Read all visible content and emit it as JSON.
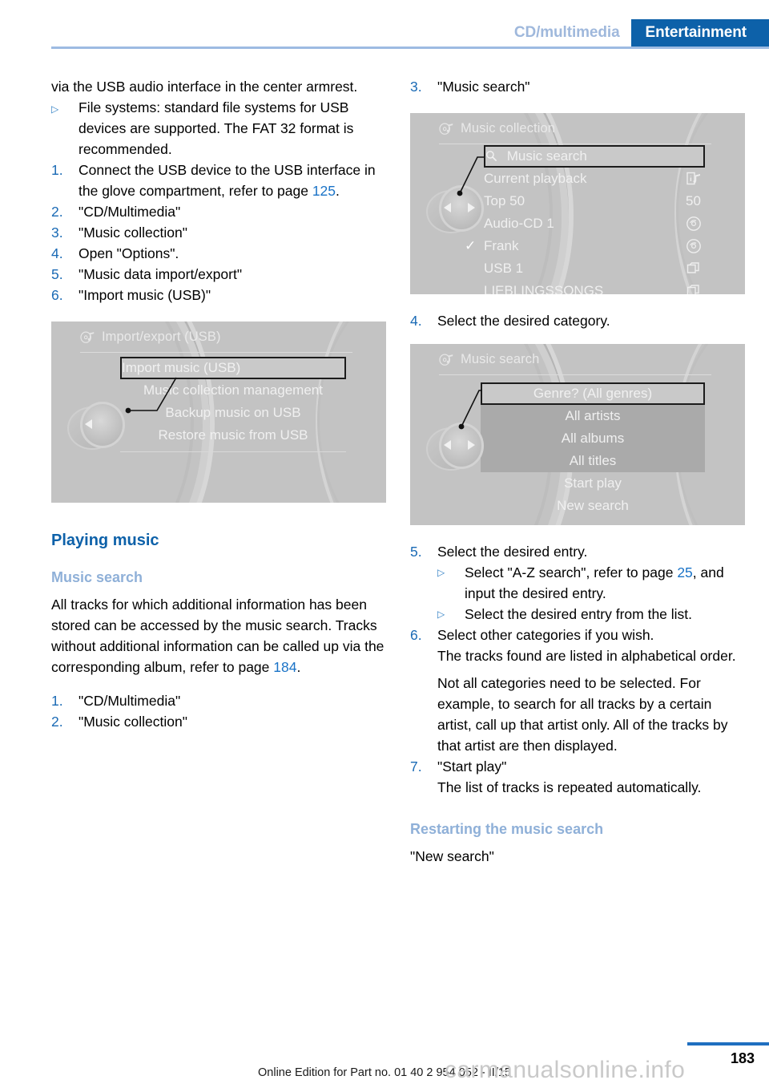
{
  "header": {
    "tab_inactive": "CD/multimedia",
    "tab_active": "Entertainment",
    "accent_color": "#0d61a9",
    "inactive_color": "#9fb8dc"
  },
  "left_column": {
    "intro_continued": "via the USB audio interface in the center armrest.",
    "bullet_filesystems": {
      "marker": "▷",
      "text": "File systems: standard file systems for USB devices are supported. The FAT 32 format is recommended."
    },
    "steps": [
      {
        "marker": "1.",
        "text_before": "Connect the USB device to the USB interface in the glove compartment, refer to page ",
        "page_ref": "125",
        "text_after": "."
      },
      {
        "marker": "2.",
        "text": "\"CD/Multimedia\""
      },
      {
        "marker": "3.",
        "text": "\"Music collection\""
      },
      {
        "marker": "4.",
        "text": "Open \"Options\"."
      },
      {
        "marker": "5.",
        "text": "\"Music data import/export\""
      },
      {
        "marker": "6.",
        "text": "\"Import music (USB)\""
      }
    ],
    "screen_import_export": {
      "title": "Import/export (USB)",
      "title_icon": "cd-music-icon",
      "items": [
        {
          "label": "Import music (USB)",
          "state": "selected"
        },
        {
          "label": "Music collection management",
          "state": "normal"
        },
        {
          "label": "Backup music on USB",
          "state": "normal"
        },
        {
          "label": "Restore music from USB",
          "state": "normal"
        }
      ]
    },
    "heading_playing_music": "Playing music",
    "heading_music_search": "Music search",
    "body_music_search": {
      "text_before": "All tracks for which additional information has been stored can be accessed by the music search. Tracks without additional information can be called up via the corresponding album, refer to page ",
      "page_ref": "184",
      "text_after": "."
    },
    "steps2": [
      {
        "marker": "1.",
        "text": "\"CD/Multimedia\""
      },
      {
        "marker": "2.",
        "text": "\"Music collection\""
      }
    ]
  },
  "right_column": {
    "step3": {
      "marker": "3.",
      "text": "\"Music search\""
    },
    "screen_music_collection": {
      "title": "Music collection",
      "title_icon": "cd-music-icon",
      "items": [
        {
          "label": "Music search",
          "state": "selected",
          "icon": "magnifier-icon",
          "right_icon": ""
        },
        {
          "label": "Current playback",
          "state": "normal",
          "right_icon": "info-music-icon"
        },
        {
          "label": "Top 50",
          "state": "normal",
          "right_icon": "50"
        },
        {
          "label": "Audio-CD 1",
          "state": "normal",
          "right_icon": "disc-icon"
        },
        {
          "label": "Frank",
          "state": "checked",
          "right_icon": "disc-icon"
        },
        {
          "label": "USB 1",
          "state": "normal",
          "right_icon": "folder-icon"
        },
        {
          "label": "LIEBLINGSSONGS",
          "state": "normal",
          "right_icon": "folder-icon"
        }
      ]
    },
    "step4": {
      "marker": "4.",
      "text": "Select the desired category."
    },
    "screen_music_search": {
      "title": "Music search",
      "title_icon": "cd-music-icon",
      "items": [
        {
          "label": "Genre? (All genres)",
          "state": "selected"
        },
        {
          "label": "All artists",
          "state": "highlight"
        },
        {
          "label": "All albums",
          "state": "highlight"
        },
        {
          "label": "All titles",
          "state": "highlight"
        },
        {
          "label": "Start play",
          "state": "normal"
        },
        {
          "label": "New search",
          "state": "normal"
        }
      ]
    },
    "step5": {
      "marker": "5.",
      "text": "Select the desired entry."
    },
    "step5_sub": [
      {
        "marker": "▷",
        "text_before": "Select \"A-Z search\", refer to page ",
        "page_ref": "25",
        "text_after": ", and input the desired entry."
      },
      {
        "marker": "▷",
        "text": "Select the desired entry from the list."
      }
    ],
    "step6": {
      "marker": "6.",
      "text": "Select other categories if you wish."
    },
    "step6_note1": "The tracks found are listed in alphabetical order.",
    "step6_note2": "Not all categories need to be selected. For example, to search for all tracks by a certain artist, call up that artist only. All of the tracks by that artist are then displayed.",
    "step7": {
      "marker": "7.",
      "text": "\"Start play\""
    },
    "step7_note": "The list of tracks is repeated automatically.",
    "heading_restarting": "Restarting the music search",
    "body_restarting": "\"New search\""
  },
  "footer": {
    "page_number": "183",
    "edition": "Online Edition for Part no. 01 40 2 954 052 - II/15",
    "watermark": "carmanualsonline.info"
  }
}
